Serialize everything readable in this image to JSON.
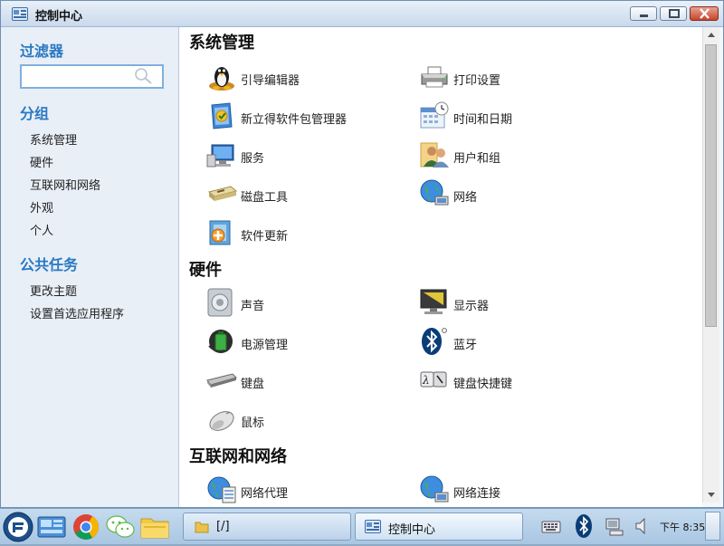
{
  "window": {
    "title": "控制中心",
    "buttons": {
      "minimize": "minimize",
      "maximize": "maximize",
      "close": "close"
    }
  },
  "sidebar": {
    "filter_heading": "过滤器",
    "search": {
      "value": "",
      "placeholder": ""
    },
    "group_heading": "分组",
    "groups": [
      "系统管理",
      "硬件",
      "互联网和网络",
      "外观",
      "个人"
    ],
    "tasks_heading": "公共任务",
    "tasks": [
      "更改主题",
      "设置首选应用程序"
    ]
  },
  "categories": [
    {
      "title": "系统管理",
      "items": [
        {
          "label": "引导编辑器",
          "icon": "tux-penguin-icon"
        },
        {
          "label": "打印设置",
          "icon": "printer-icon"
        },
        {
          "label": "新立得软件包管理器",
          "icon": "package-manager-icon"
        },
        {
          "label": "时间和日期",
          "icon": "calendar-clock-icon"
        },
        {
          "label": "服务",
          "icon": "services-monitor-icon"
        },
        {
          "label": "用户和组",
          "icon": "users-group-icon"
        },
        {
          "label": "磁盘工具",
          "icon": "disk-drive-icon"
        },
        {
          "label": "网络",
          "icon": "network-globe-icon"
        },
        {
          "label": "软件更新",
          "icon": "software-update-icon"
        }
      ]
    },
    {
      "title": "硬件",
      "items": [
        {
          "label": "声音",
          "icon": "speaker-icon"
        },
        {
          "label": "显示器",
          "icon": "display-icon"
        },
        {
          "label": "电源管理",
          "icon": "battery-icon"
        },
        {
          "label": "蓝牙",
          "icon": "bluetooth-icon"
        },
        {
          "label": "键盘",
          "icon": "keyboard-icon"
        },
        {
          "label": "键盘快捷键",
          "icon": "keyboard-shortcut-icon"
        },
        {
          "label": "鼠标",
          "icon": "mouse-icon"
        }
      ]
    },
    {
      "title": "互联网和网络",
      "items": [
        {
          "label": "网络代理",
          "icon": "network-proxy-icon"
        },
        {
          "label": "网络连接",
          "icon": "network-connection-icon"
        }
      ]
    }
  ],
  "taskbar": {
    "windows": [
      {
        "label": "[/]",
        "icon": "folder-icon"
      },
      {
        "label": "控制中心",
        "icon": "control-center-icon"
      }
    ],
    "launchers": [
      "start-menu-icon",
      "control-panel-icon",
      "chrome-icon",
      "wechat-icon",
      "file-manager-icon"
    ],
    "tray": [
      "keyboard-input-icon",
      "bluetooth-tray-icon",
      "network-tray-icon",
      "volume-icon"
    ],
    "clock": "下午 8:35"
  },
  "colors": {
    "accent_heading": "#2a78c2",
    "titlebar_top": "#e9f0f8",
    "titlebar_bottom": "#c9d9ec",
    "sidebar_bg": "#e8eff7",
    "close_button": "#c6452b",
    "taskbar": "#b8d1ea"
  }
}
